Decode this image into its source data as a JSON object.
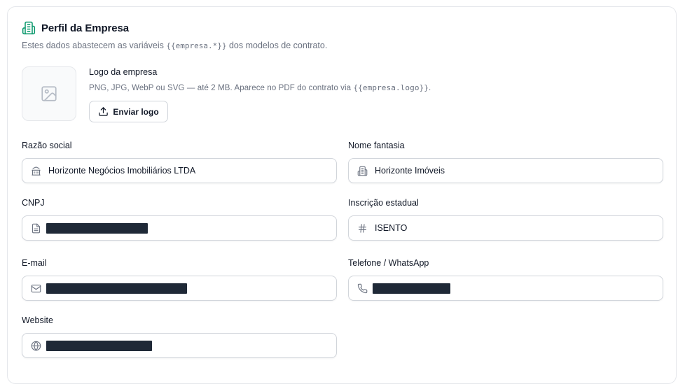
{
  "header": {
    "title": "Perfil da Empresa",
    "subtitle_before": "Estes dados abastecem as variáveis",
    "subtitle_code": "{{empresa.*}}",
    "subtitle_after": "dos modelos de contrato."
  },
  "logo": {
    "title": "Logo da empresa",
    "hint_before": "PNG, JPG, WebP ou SVG — até 2 MB. Aparece no PDF do contrato via",
    "hint_code": "{{empresa.logo}}",
    "hint_after": ".",
    "upload_label": "Enviar logo"
  },
  "fields": {
    "razao_social": {
      "label": "Razão social",
      "value": "Horizonte Negócios Imobiliários LTDA",
      "icon": "bank-icon"
    },
    "nome_fantasia": {
      "label": "Nome fantasia",
      "value": "Horizonte Imóveis",
      "icon": "building-icon"
    },
    "cnpj": {
      "label": "CNPJ",
      "value": "",
      "redacted": true,
      "icon": "document-icon"
    },
    "inscricao_estadual": {
      "label": "Inscrição estadual",
      "value": "ISENTO",
      "icon": "hash-icon"
    },
    "email": {
      "label": "E-mail",
      "value": "",
      "redacted": true,
      "icon": "mail-icon"
    },
    "telefone": {
      "label": "Telefone / WhatsApp",
      "value": "",
      "redacted": true,
      "icon": "phone-icon"
    },
    "website": {
      "label": "Website",
      "value": "",
      "redacted": true,
      "icon": "globe-icon"
    }
  },
  "colors": {
    "accent": "#059669",
    "border": "#d1d5db",
    "muted_text": "#6b7280",
    "redaction": "#1f2937"
  }
}
